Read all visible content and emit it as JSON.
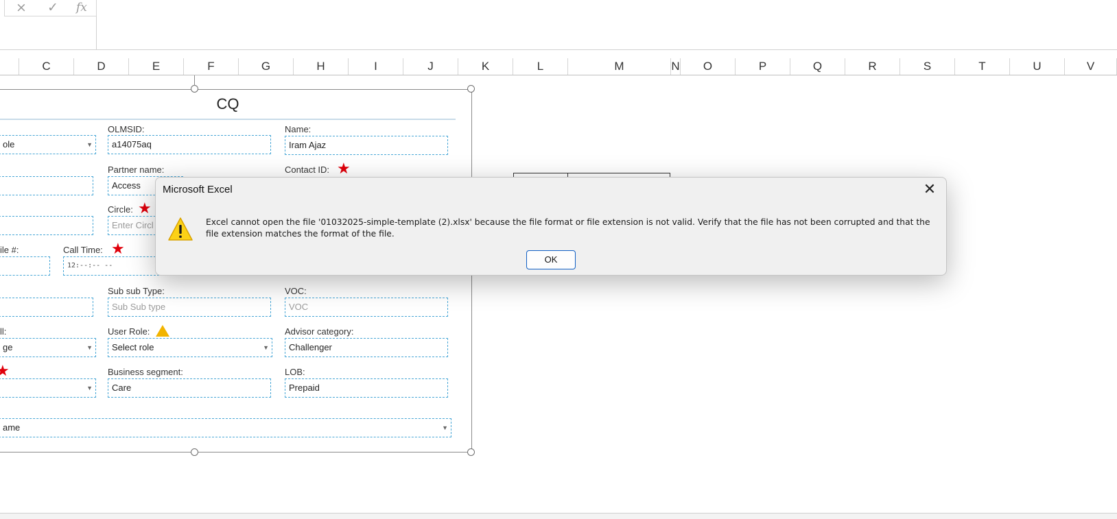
{
  "formula_bar": {
    "cancel_icon": "×",
    "enter_icon": "✓",
    "fx_label": "fx"
  },
  "columns": [
    "C",
    "D",
    "E",
    "F",
    "G",
    "H",
    "I",
    "J",
    "K",
    "L",
    "M",
    "N",
    "O",
    "P",
    "Q",
    "R",
    "S",
    "T",
    "U",
    "V"
  ],
  "form": {
    "title": "CQ",
    "partial_field_top_left": "ole",
    "olmsid_label": "OLMSID:",
    "olmsid_value": "a14075aq",
    "name_label": "Name:",
    "name_value": "Iram Ajaz",
    "partner_label": "Partner name:",
    "partner_value": "Access",
    "contact_label": "Contact ID:",
    "circle_label": "Circle:",
    "circle_placeholder": "Enter Circl",
    "mobile_label": "ile #:",
    "calltime_label": "Call Time:",
    "calltime_value": "12:--:-- --",
    "subsubtype_label": "Sub sub Type:",
    "subsubtype_placeholder": "Sub Sub type",
    "voc_label": "VOC:",
    "voc_placeholder": "VOC",
    "partial_label_ll": "ll:",
    "partial_field_ge": "ge",
    "userrole_label": "User Role:",
    "userrole_value": "Select role",
    "advisor_label": "Advisor category:",
    "advisor_value": "Challenger",
    "segment_label": "Business segment:",
    "segment_value": "Care",
    "lob_label": "LOB:",
    "lob_value": "Prepaid",
    "partial_field_bottom": "ame",
    "star_glyph": "★"
  },
  "dialog": {
    "title": "Microsoft Excel",
    "close_icon": "✕",
    "message": "Excel cannot open the file '01032025-simple-template (2).xlsx' because the file format or file extension is not valid. Verify that the file has not been corrupted and that the file extension matches the format of the file.",
    "ok_label": "OK",
    "icon": "warning-icon"
  },
  "colors": {
    "field_border": "#47a6d6",
    "star": "#e0000b",
    "warning": "#f2b400",
    "ok_border": "#0f5fc4"
  }
}
